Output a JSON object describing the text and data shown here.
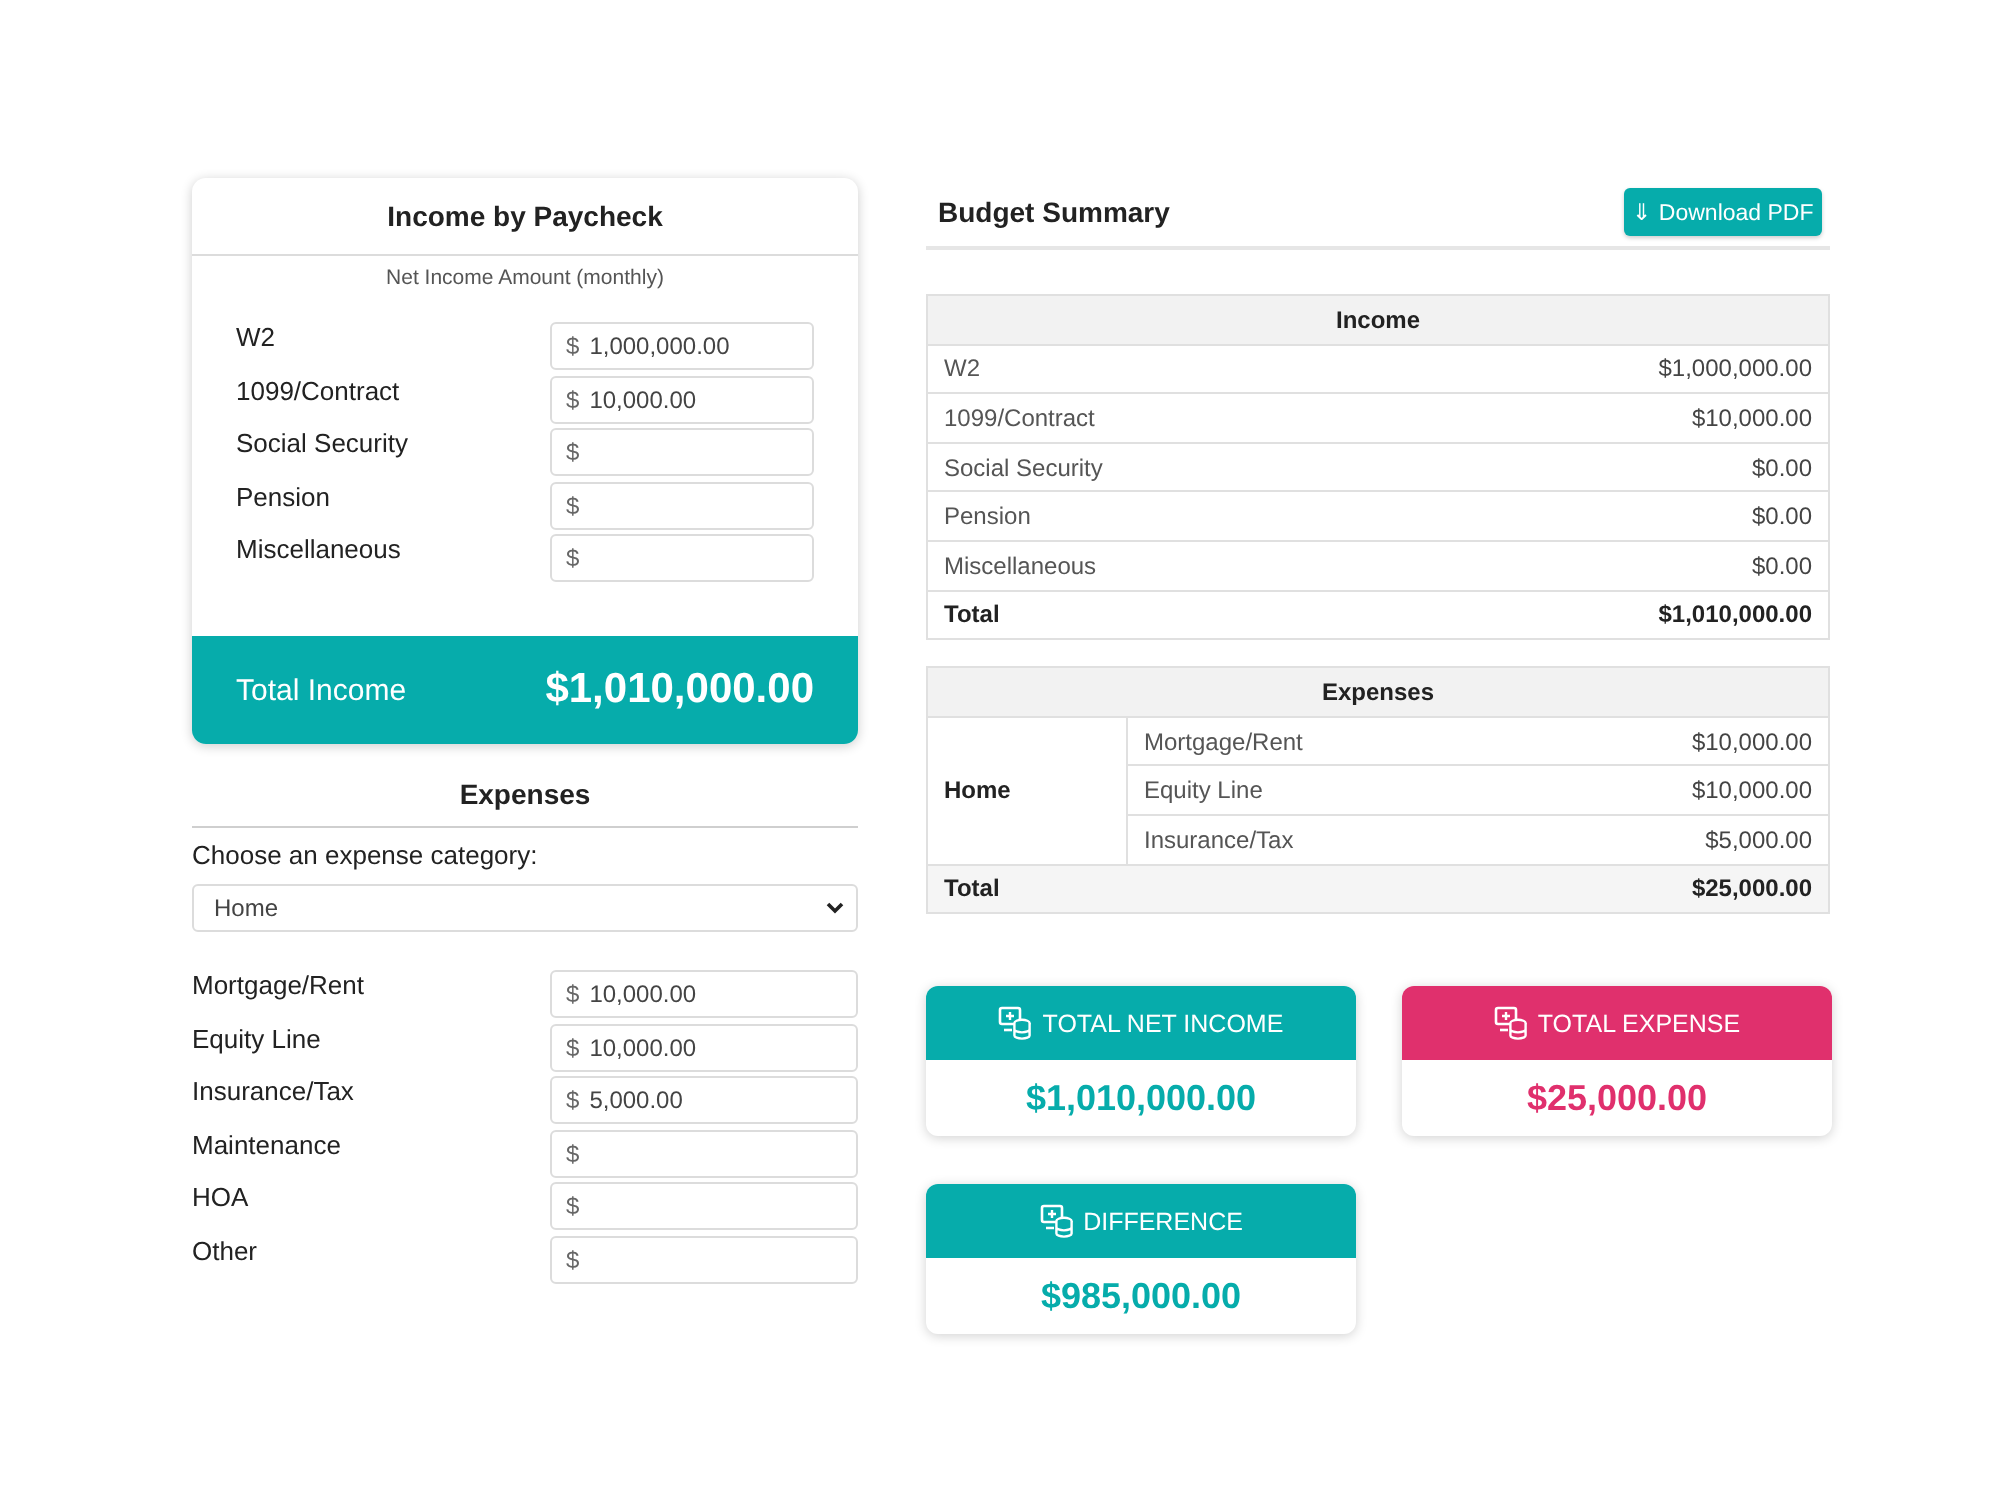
{
  "income_card": {
    "title": "Income by Paycheck",
    "subtitle": "Net Income Amount (monthly)",
    "fields": [
      {
        "label": "W2",
        "prefix": "$",
        "value": "1,000,000.00"
      },
      {
        "label": "1099/Contract",
        "prefix": "$",
        "value": "10,000.00"
      },
      {
        "label": "Social Security",
        "prefix": "$"
      },
      {
        "label": "Pension",
        "prefix": "$"
      },
      {
        "label": "Miscellaneous",
        "prefix": "$"
      }
    ],
    "total": {
      "label": "Total Income",
      "value": "$1,010,000.00"
    }
  },
  "expenses_form": {
    "title": "Expenses",
    "category_label": "Choose an expense category:",
    "category_select": {
      "value": "Home"
    },
    "fields": [
      {
        "label": "Mortgage/Rent",
        "prefix": "$",
        "value": "10,000.00"
      },
      {
        "label": "Equity Line",
        "prefix": "$",
        "value": "10,000.00"
      },
      {
        "label": "Insurance/Tax",
        "prefix": "$",
        "value": "5,000.00"
      },
      {
        "label": "Maintenance",
        "prefix": "$"
      },
      {
        "label": "HOA",
        "prefix": "$"
      },
      {
        "label": "Other",
        "prefix": "$"
      }
    ]
  },
  "summary": {
    "title": "Budget Summary",
    "download_button": {
      "label": "⇓ Download PDF"
    },
    "income_table": {
      "heading": "Income",
      "rows": [
        {
          "label": "W2",
          "amount": "$1,000,000.00"
        },
        {
          "label": "1099/Contract",
          "amount": "$10,000.00"
        },
        {
          "label": "Social Security",
          "amount": "$0.00"
        },
        {
          "label": "Pension",
          "amount": "$0.00"
        },
        {
          "label": "Miscellaneous",
          "amount": "$0.00"
        }
      ],
      "total": {
        "label": "Total",
        "amount": "$1,010,000.00"
      }
    },
    "expenses_table": {
      "heading": "Expenses",
      "groups": [
        {
          "category": "Home",
          "rows": [
            {
              "label": "Mortgage/Rent",
              "amount": "$10,000.00"
            },
            {
              "label": "Equity Line",
              "amount": "$10,000.00"
            },
            {
              "label": "Insurance/Tax",
              "amount": "$5,000.00"
            }
          ]
        }
      ],
      "total": {
        "label": "Total",
        "amount": "$25,000.00"
      }
    },
    "stat_cards": [
      {
        "title": "TOTAL NET INCOME",
        "value": "$1,010,000.00",
        "color": "#06acab"
      },
      {
        "title": "TOTAL EXPENSE",
        "value": "$25,000.00",
        "color": "#e0306d"
      },
      {
        "title": "DIFFERENCE",
        "value": "$985,000.00",
        "color": "#06acab"
      }
    ]
  }
}
